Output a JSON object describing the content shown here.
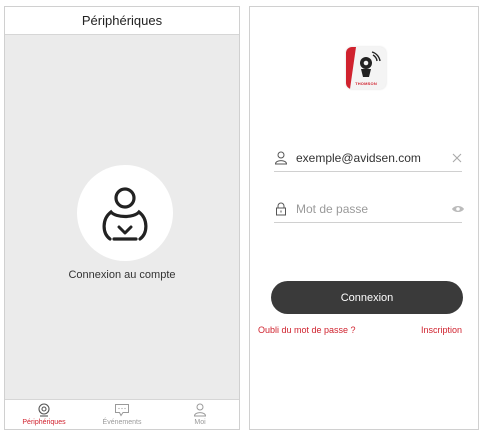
{
  "left_screen": {
    "header_title": "Périphériques",
    "login_caption": "Connexion au compte",
    "tabs": [
      {
        "label": "Périphériques",
        "icon": "camera-icon",
        "active": true
      },
      {
        "label": "Événements",
        "icon": "message-icon",
        "active": false
      },
      {
        "label": "Moi",
        "icon": "user-icon",
        "active": false
      }
    ]
  },
  "right_screen": {
    "brand": "THOMSON",
    "email_field": {
      "value": "exemple@avidsen.com",
      "icon": "user-icon",
      "action_icon": "clear-icon"
    },
    "password_field": {
      "placeholder": "Mot de passe",
      "icon": "lock-icon",
      "action_icon": "eye-icon"
    },
    "login_button": "Connexion",
    "forgot_password": "Oubli du mot de passe ?",
    "signup": "Inscription"
  },
  "colors": {
    "accent": "#d0222e",
    "button": "#3a3a3a",
    "background_gray": "#ebebeb"
  }
}
